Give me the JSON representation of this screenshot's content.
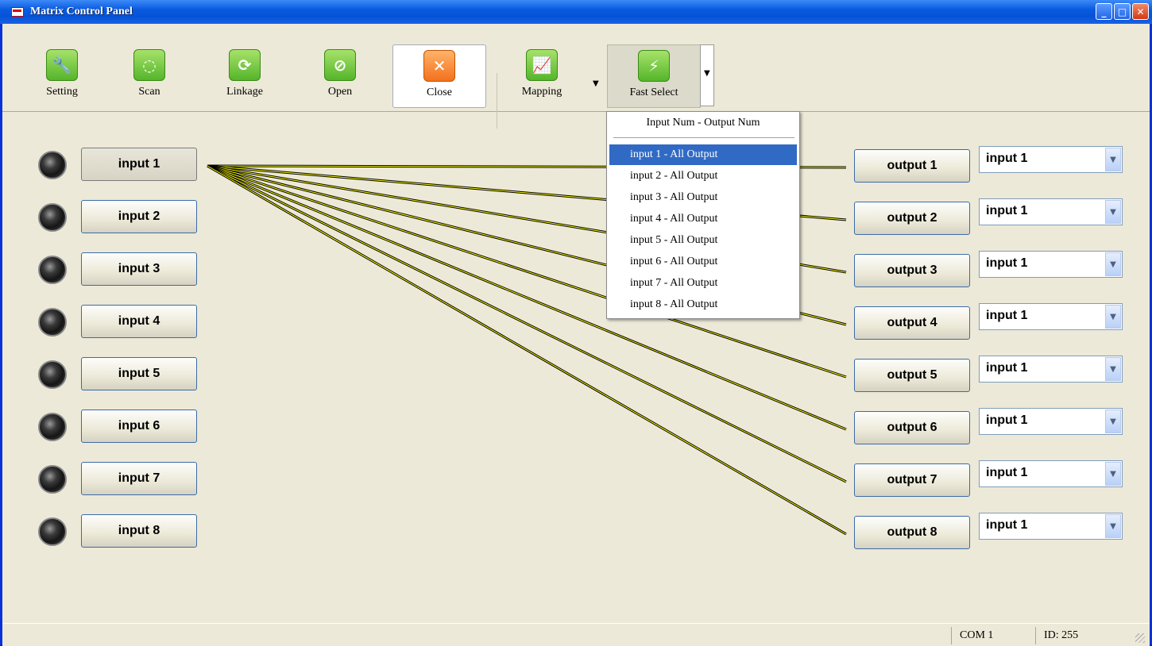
{
  "window": {
    "title": "Matrix Control Panel",
    "controls": {
      "minimize": "_",
      "maximize": "□",
      "close": "✕"
    }
  },
  "toolbar": {
    "buttons": [
      {
        "label": "Setting",
        "icon": "wrench-icon"
      },
      {
        "label": "Scan",
        "icon": "scan-icon"
      },
      {
        "label": "Linkage",
        "icon": "refresh-icon"
      },
      {
        "label": "Open",
        "icon": "link-icon"
      },
      {
        "label": "Close",
        "icon": "close-icon"
      },
      {
        "label": "Mapping",
        "icon": "chart-icon"
      },
      {
        "label": "Fast Select",
        "icon": "lightning-icon"
      }
    ]
  },
  "fast_select_menu": {
    "header": "Input Num - Output Num",
    "items": [
      "input 1 - All Output",
      "input 2 - All Output",
      "input 3 - All Output",
      "input 4 - All Output",
      "input 5 - All Output",
      "input 6 - All Output",
      "input 7 - All Output",
      "input 8 - All Output"
    ],
    "highlighted_index": 0
  },
  "inputs": [
    "input 1",
    "input 2",
    "input 3",
    "input 4",
    "input 5",
    "input 6",
    "input 7",
    "input 8"
  ],
  "outputs": [
    {
      "label": "output 1",
      "source": "input 1"
    },
    {
      "label": "output 2",
      "source": "input 1"
    },
    {
      "label": "output 3",
      "source": "input 1"
    },
    {
      "label": "output 4",
      "source": "input 1"
    },
    {
      "label": "output 5",
      "source": "input 1"
    },
    {
      "label": "output 6",
      "source": "input 1"
    },
    {
      "label": "output 7",
      "source": "input 1"
    },
    {
      "label": "output 8",
      "source": "input 1"
    }
  ],
  "colors": {
    "route_line": "#ffff00",
    "highlight": "#316ac5"
  },
  "status": {
    "port": "COM 1",
    "id": "ID: 255"
  }
}
